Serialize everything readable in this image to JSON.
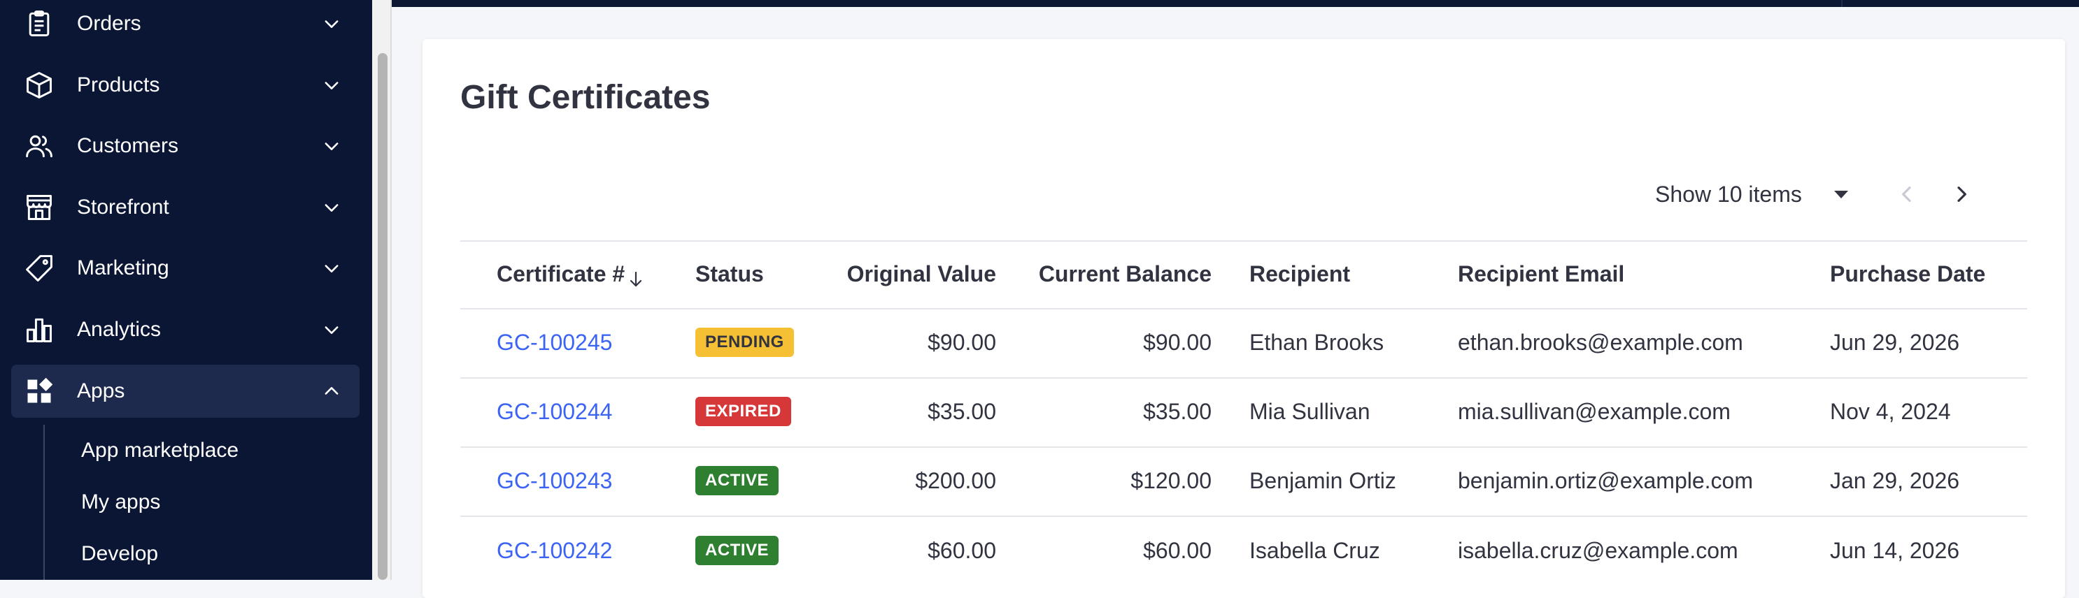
{
  "sidebar": {
    "items": [
      {
        "label": "Orders",
        "icon": "clipboard-icon"
      },
      {
        "label": "Products",
        "icon": "box-icon"
      },
      {
        "label": "Customers",
        "icon": "users-icon"
      },
      {
        "label": "Storefront",
        "icon": "store-icon"
      },
      {
        "label": "Marketing",
        "icon": "tag-icon"
      },
      {
        "label": "Analytics",
        "icon": "bar-chart-icon"
      },
      {
        "label": "Apps",
        "icon": "apps-icon",
        "expanded": true
      }
    ],
    "apps_subitems": [
      "App marketplace",
      "My apps",
      "Develop"
    ]
  },
  "main": {
    "title": "Gift Certificates",
    "pager": {
      "label": "Show 10 items"
    },
    "table": {
      "columns": [
        "Certificate #",
        "Status",
        "Original Value",
        "Current Balance",
        "Recipient",
        "Recipient Email",
        "Purchase Date"
      ],
      "rows": [
        {
          "id": "GC-100245",
          "status": "PENDING",
          "original": "$90.00",
          "balance": "$90.00",
          "recipient": "Ethan Brooks",
          "email": "ethan.brooks@example.com",
          "date": "Jun 29, 2026"
        },
        {
          "id": "GC-100244",
          "status": "EXPIRED",
          "original": "$35.00",
          "balance": "$35.00",
          "recipient": "Mia Sullivan",
          "email": "mia.sullivan@example.com",
          "date": "Nov 4, 2024"
        },
        {
          "id": "GC-100243",
          "status": "ACTIVE",
          "original": "$200.00",
          "balance": "$120.00",
          "recipient": "Benjamin Ortiz",
          "email": "benjamin.ortiz@example.com",
          "date": "Jan 29, 2026"
        },
        {
          "id": "GC-100242",
          "status": "ACTIVE",
          "original": "$60.00",
          "balance": "$60.00",
          "recipient": "Isabella Cruz",
          "email": "isabella.cruz@example.com",
          "date": "Jun 14, 2026"
        }
      ]
    }
  },
  "colors": {
    "sidebar_bg": "#0b1634",
    "link": "#3c64f4",
    "pending": "#f5c034",
    "expired": "#d6383a",
    "active": "#2e8030"
  }
}
